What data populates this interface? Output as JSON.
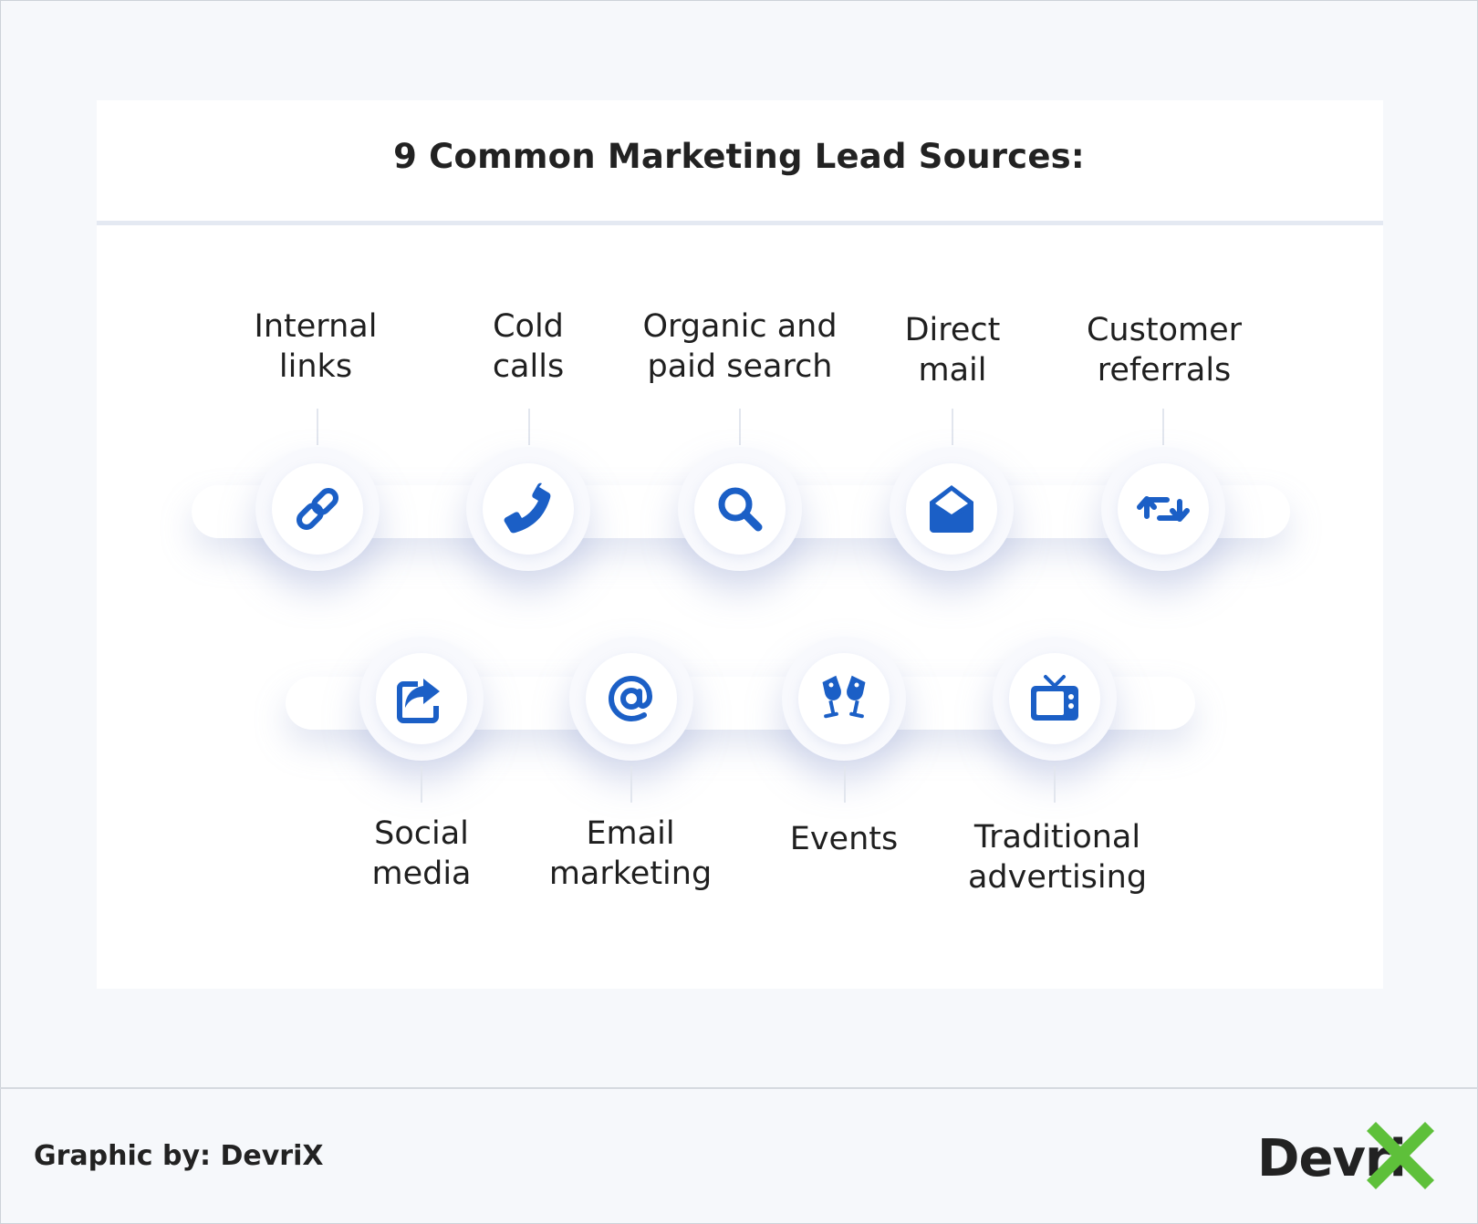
{
  "title": "9 Common Marketing Lead Sources:",
  "colors": {
    "icon": "#1b5fc6",
    "logo_x": "#5ec03a",
    "text": "#1f1f1f"
  },
  "sources_top": [
    {
      "line1": "Internal",
      "line2": "links",
      "icon": "link-icon"
    },
    {
      "line1": "Cold",
      "line2": "calls",
      "icon": "phone-icon"
    },
    {
      "line1": "Organic and",
      "line2": "paid search",
      "icon": "search-icon"
    },
    {
      "line1": "Direct",
      "line2": "mail",
      "icon": "envelope-open-icon"
    },
    {
      "line1": "Customer",
      "line2": "referrals",
      "icon": "retweet-icon"
    }
  ],
  "sources_bottom": [
    {
      "line1": "Social",
      "line2": "media",
      "icon": "share-icon"
    },
    {
      "line1": "Email",
      "line2": "marketing",
      "icon": "at-icon"
    },
    {
      "line1": "Events",
      "line2": "",
      "icon": "glasses-cheers-icon"
    },
    {
      "line1": "Traditional",
      "line2": "advertising",
      "icon": "tv-icon"
    }
  ],
  "footer": {
    "credit": "Graphic by: DevriX",
    "logo_text": "Devri"
  }
}
